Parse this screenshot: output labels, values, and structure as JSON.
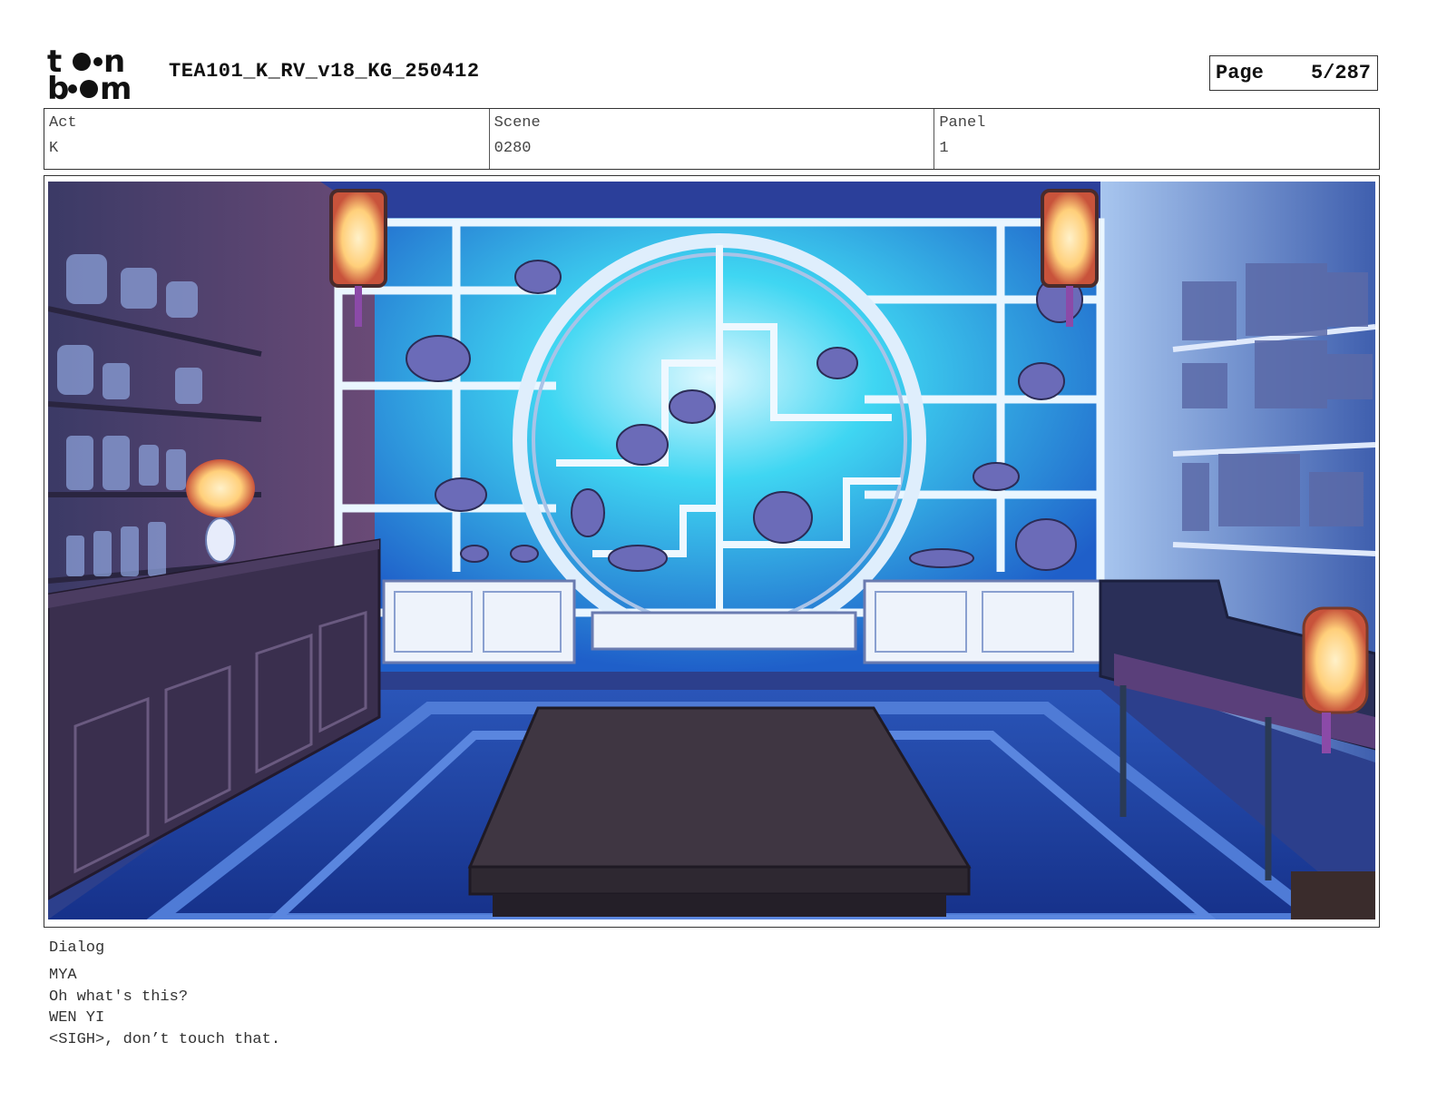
{
  "header": {
    "logo_text": "toon boom",
    "doc_title": "TEA101_K_RV_v18_KG_250412",
    "page_label": "Page",
    "page_value": "5/287"
  },
  "info": {
    "act_label": "Act",
    "act_value": "K",
    "scene_label": "Scene",
    "scene_value": "0280",
    "panel_label": "Panel",
    "panel_value": "1"
  },
  "dialog": {
    "label": "Dialog",
    "lines": [
      "MYA",
      "Oh what's this?",
      "WEN YI",
      "<SIGH>, don’t touch that."
    ]
  },
  "colors": {
    "backdrop_glow": "#3fd6f2",
    "floor_blue": "#1e3f9c",
    "cabinet_purple": "#3a2f4e",
    "lantern_glow": "#ffcf7a"
  }
}
